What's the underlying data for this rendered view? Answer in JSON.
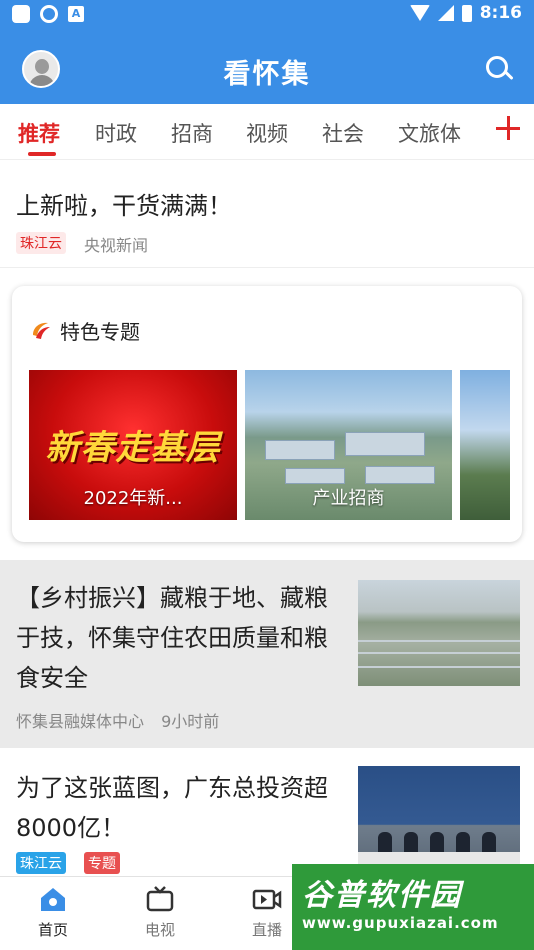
{
  "status_bar": {
    "time": "8:16"
  },
  "header": {
    "title": "看怀集"
  },
  "tabs": [
    {
      "label": "推荐"
    },
    {
      "label": "时政"
    },
    {
      "label": "招商"
    },
    {
      "label": "视频"
    },
    {
      "label": "社会"
    },
    {
      "label": "文旅体"
    }
  ],
  "news": [
    {
      "title": "上新啦，干货满满！",
      "badge": "珠江云",
      "source": "央视新闻"
    },
    {
      "title": "【乡村振兴】藏粮于地、藏粮于技，怀集守住农田质量和粮食安全",
      "source": "怀集县融媒体中心",
      "time": "9小时前"
    },
    {
      "title": "为了这张蓝图，广东总投资超8000亿！",
      "badges": [
        "珠江云",
        "专题"
      ]
    }
  ],
  "special": {
    "title": "特色专题",
    "items": [
      {
        "caption": "2022年新...",
        "overlay_text": "新春走基层"
      },
      {
        "caption": "产业招商"
      }
    ]
  },
  "bottom_nav": [
    {
      "label": "首页"
    },
    {
      "label": "电视"
    },
    {
      "label": "直播"
    }
  ],
  "watermark": {
    "main": "谷普软件园",
    "url": "www.gupuxiazai.com"
  },
  "colors": {
    "primary_blue": "#3a8ee6",
    "accent_red": "#e02727"
  }
}
